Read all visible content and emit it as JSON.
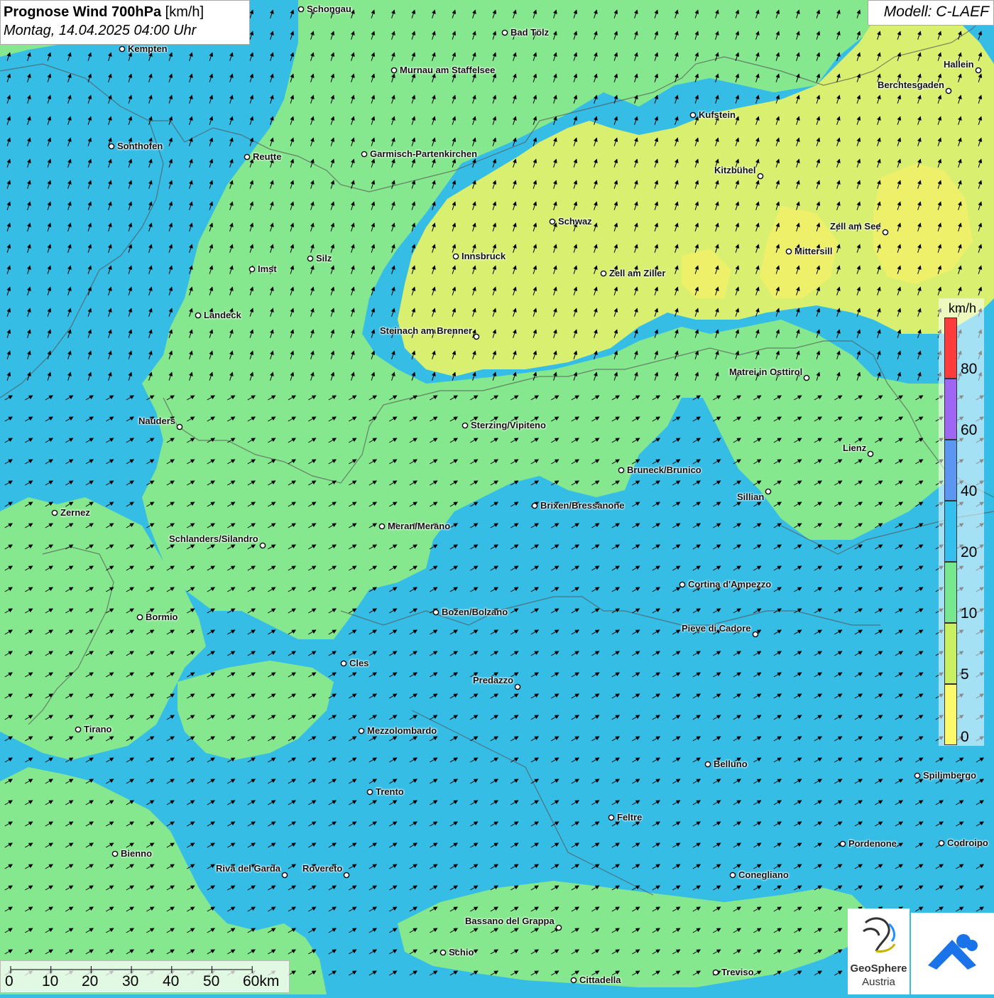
{
  "header": {
    "title_bold": "Prognose Wind 700hPa",
    "title_unit": "[km/h]",
    "datetime": "Montag, 14.04.2025 04:00 Uhr"
  },
  "model": {
    "label": "Modell: C-LAEF"
  },
  "legend": {
    "unit": "km/h",
    "labels": [
      "80",
      "60",
      "40",
      "20",
      "10",
      "5",
      "0"
    ],
    "colors": [
      "#ff3b3b",
      "#9e66f2",
      "#5a96f2",
      "#33c0ee",
      "#77e88f",
      "#c8f060",
      "#fdf96a"
    ]
  },
  "scalebar": {
    "labels": [
      "0",
      "10",
      "20",
      "30",
      "40",
      "50",
      "60km"
    ]
  },
  "logo": {
    "name": "GeoSphere",
    "country": "Austria"
  },
  "cities": [
    {
      "name": "Schongau"
    },
    {
      "name": "Bad Tölz"
    },
    {
      "name": "Kempten"
    },
    {
      "name": "Murnau am Staffelsee"
    },
    {
      "name": "Hallein"
    },
    {
      "name": "Berchtesgaden"
    },
    {
      "name": "Kufstein"
    },
    {
      "name": "Sonthofen"
    },
    {
      "name": "Reutte"
    },
    {
      "name": "Garmisch-Partenkirchen"
    },
    {
      "name": "Kitzbühel"
    },
    {
      "name": "Schwaz"
    },
    {
      "name": "Zell am See"
    },
    {
      "name": "Innsbruck"
    },
    {
      "name": "Mittersill"
    },
    {
      "name": "Imst"
    },
    {
      "name": "Silz"
    },
    {
      "name": "Zell am Ziller"
    },
    {
      "name": "Landeck"
    },
    {
      "name": "Steinach am Brenner"
    },
    {
      "name": "Matrei in Osttirol"
    },
    {
      "name": "Nauders"
    },
    {
      "name": "Sterzing/Vipiteno"
    },
    {
      "name": "Lienz"
    },
    {
      "name": "Bruneck/Brunico"
    },
    {
      "name": "Sillian"
    },
    {
      "name": "Zernez"
    },
    {
      "name": "Brixen/Bressanone"
    },
    {
      "name": "Meran/Merano"
    },
    {
      "name": "Schlanders/Silandro"
    },
    {
      "name": "Cortina d'Ampezzo"
    },
    {
      "name": "Bormio"
    },
    {
      "name": "Bozen/Bolzano"
    },
    {
      "name": "Pieve di Cadore"
    },
    {
      "name": "Cles"
    },
    {
      "name": "Predazzo"
    },
    {
      "name": "Tirano"
    },
    {
      "name": "Mezzolombardo"
    },
    {
      "name": "Belluno"
    },
    {
      "name": "Spilimbergo"
    },
    {
      "name": "Trento"
    },
    {
      "name": "Feltre"
    },
    {
      "name": "Pordenone"
    },
    {
      "name": "Codroipo"
    },
    {
      "name": "Bienno"
    },
    {
      "name": "Riva del Garda"
    },
    {
      "name": "Rovereto"
    },
    {
      "name": "Conegliano"
    },
    {
      "name": "Bassano del Grappa"
    },
    {
      "name": "Schio"
    },
    {
      "name": "Treviso"
    },
    {
      "name": "Cittadella"
    }
  ]
}
